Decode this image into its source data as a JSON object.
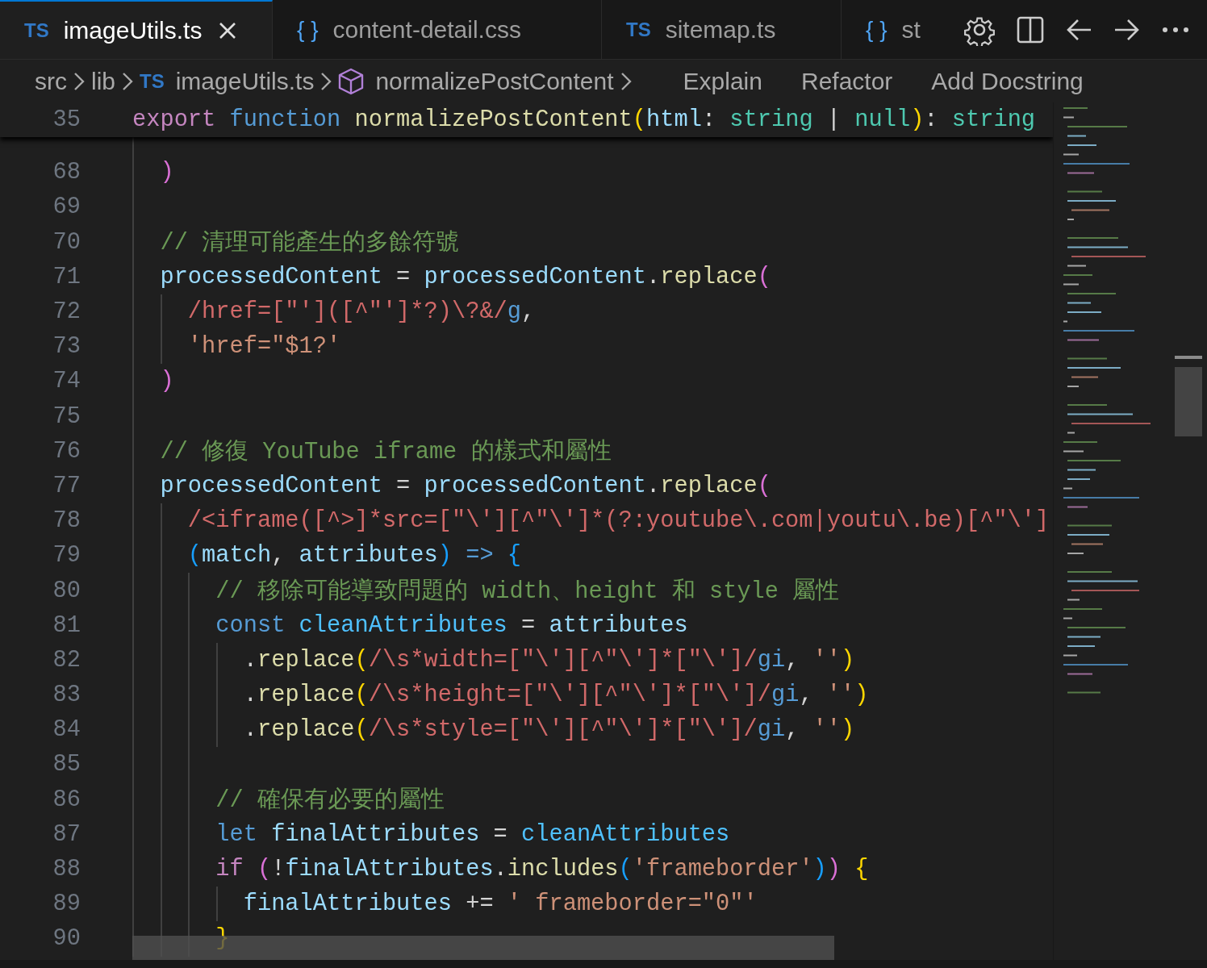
{
  "tabs": [
    {
      "icon": "TS",
      "kind": "ts",
      "label": "imageUtils.ts",
      "selected": true
    },
    {
      "icon": "{ }",
      "kind": "css",
      "label": "content-detail.css",
      "selected": false
    },
    {
      "icon": "TS",
      "kind": "ts",
      "label": "sitemap.ts",
      "selected": false
    },
    {
      "icon": "{ }",
      "kind": "css",
      "label": "st",
      "selected": false
    }
  ],
  "breadcrumb": [
    {
      "label": "src",
      "kind": "folder"
    },
    {
      "label": "lib",
      "kind": "folder"
    },
    {
      "label": "imageUtils.ts",
      "kind": "file",
      "icon": "TS"
    },
    {
      "label": "normalizePostContent",
      "kind": "symbol"
    }
  ],
  "actions": [
    "Explain",
    "Refactor",
    "Add Docstring"
  ],
  "sticky_line": {
    "number": "35",
    "tokens": [
      {
        "text": "export",
        "kind": "kw"
      },
      {
        "text": " function",
        "kind": "st"
      },
      {
        "text": " normalizePostContent",
        "kind": "fn"
      },
      {
        "text": "(",
        "kind": "b1"
      },
      {
        "text": "html",
        "kind": "var"
      },
      {
        "text": ": ",
        "kind": "p"
      },
      {
        "text": "string",
        "kind": "type"
      },
      {
        "text": " | ",
        "kind": "p"
      },
      {
        "text": "null",
        "kind": "type"
      },
      {
        "text": ")",
        "kind": "b1"
      },
      {
        "text": ": ",
        "kind": "p"
      },
      {
        "text": "string",
        "kind": "type"
      }
    ]
  },
  "lines": [
    {
      "number": "68",
      "tokens": [
        {
          "text": "  )",
          "kind": "b2"
        }
      ]
    },
    {
      "number": "69"
    },
    {
      "number": "70",
      "tokens": [
        {
          "text": "  // 清理可能產生的多餘符號",
          "kind": "cm"
        }
      ]
    },
    {
      "number": "71",
      "tokens": [
        {
          "text": "  processedContent",
          "kind": "var"
        },
        {
          "text": " = ",
          "kind": "p"
        },
        {
          "text": "processedContent",
          "kind": "var"
        },
        {
          "text": ".",
          "kind": "p"
        },
        {
          "text": "replace",
          "kind": "fn"
        },
        {
          "text": "(",
          "kind": "b2"
        }
      ]
    },
    {
      "number": "72",
      "tokens": [
        {
          "text": "    /href=[\"']([^\"']*?)\\?&/",
          "kind": "re"
        },
        {
          "text": "g",
          "kind": "flag"
        },
        {
          "text": ",",
          "kind": "p"
        }
      ]
    },
    {
      "number": "73",
      "tokens": [
        {
          "text": "    'href=\"$1?'",
          "kind": "str"
        }
      ]
    },
    {
      "number": "74",
      "tokens": [
        {
          "text": "  )",
          "kind": "b2"
        }
      ]
    },
    {
      "number": "75"
    },
    {
      "number": "76",
      "tokens": [
        {
          "text": "  // 修復 YouTube iframe 的樣式和屬性",
          "kind": "cm"
        }
      ]
    },
    {
      "number": "77",
      "tokens": [
        {
          "text": "  processedContent",
          "kind": "var"
        },
        {
          "text": " = ",
          "kind": "p"
        },
        {
          "text": "processedContent",
          "kind": "var"
        },
        {
          "text": ".",
          "kind": "p"
        },
        {
          "text": "replace",
          "kind": "fn"
        },
        {
          "text": "(",
          "kind": "b2"
        }
      ]
    },
    {
      "number": "78",
      "tokens": [
        {
          "text": "    /<iframe([^>]*src=[\"\\'][^\"\\']*(?:youtube\\.com|youtu\\.be)[^\"\\']",
          "kind": "re"
        }
      ]
    },
    {
      "number": "79",
      "tokens": [
        {
          "text": "    (",
          "kind": "b3"
        },
        {
          "text": "match",
          "kind": "var"
        },
        {
          "text": ", ",
          "kind": "p"
        },
        {
          "text": "attributes",
          "kind": "var"
        },
        {
          "text": ")",
          "kind": "b3"
        },
        {
          "text": " =>",
          "kind": "st"
        },
        {
          "text": " {",
          "kind": "b3"
        }
      ]
    },
    {
      "number": "80",
      "tokens": [
        {
          "text": "      // 移除可能導致問題的 width、height 和 style 屬性",
          "kind": "cm"
        }
      ]
    },
    {
      "number": "81",
      "tokens": [
        {
          "text": "      const",
          "kind": "st"
        },
        {
          "text": " cleanAttributes",
          "kind": "const"
        },
        {
          "text": " = ",
          "kind": "p"
        },
        {
          "text": "attributes",
          "kind": "var"
        }
      ]
    },
    {
      "number": "82",
      "tokens": [
        {
          "text": "        .",
          "kind": "p"
        },
        {
          "text": "replace",
          "kind": "fn"
        },
        {
          "text": "(",
          "kind": "b1"
        },
        {
          "text": "/\\s*width=[\"\\'][^\"\\']*[\"\\']/",
          "kind": "re"
        },
        {
          "text": "gi",
          "kind": "flag"
        },
        {
          "text": ", ",
          "kind": "p"
        },
        {
          "text": "''",
          "kind": "str"
        },
        {
          "text": ")",
          "kind": "b1"
        }
      ]
    },
    {
      "number": "83",
      "tokens": [
        {
          "text": "        .",
          "kind": "p"
        },
        {
          "text": "replace",
          "kind": "fn"
        },
        {
          "text": "(",
          "kind": "b1"
        },
        {
          "text": "/\\s*height=[\"\\'][^\"\\']*[\"\\']/",
          "kind": "re"
        },
        {
          "text": "gi",
          "kind": "flag"
        },
        {
          "text": ", ",
          "kind": "p"
        },
        {
          "text": "''",
          "kind": "str"
        },
        {
          "text": ")",
          "kind": "b1"
        }
      ]
    },
    {
      "number": "84",
      "tokens": [
        {
          "text": "        .",
          "kind": "p"
        },
        {
          "text": "replace",
          "kind": "fn"
        },
        {
          "text": "(",
          "kind": "b1"
        },
        {
          "text": "/\\s*style=[\"\\'][^\"\\']*[\"\\']/",
          "kind": "re"
        },
        {
          "text": "gi",
          "kind": "flag"
        },
        {
          "text": ", ",
          "kind": "p"
        },
        {
          "text": "''",
          "kind": "str"
        },
        {
          "text": ")",
          "kind": "b1"
        }
      ]
    },
    {
      "number": "85"
    },
    {
      "number": "86",
      "tokens": [
        {
          "text": "      // 確保有必要的屬性",
          "kind": "cm"
        }
      ]
    },
    {
      "number": "87",
      "tokens": [
        {
          "text": "      let",
          "kind": "st"
        },
        {
          "text": " finalAttributes",
          "kind": "var"
        },
        {
          "text": " = ",
          "kind": "p"
        },
        {
          "text": "cleanAttributes",
          "kind": "const"
        }
      ]
    },
    {
      "number": "88",
      "tokens": [
        {
          "text": "      if",
          "kind": "kw"
        },
        {
          "text": " (",
          "kind": "b2"
        },
        {
          "text": "!",
          "kind": "p"
        },
        {
          "text": "finalAttributes",
          "kind": "var"
        },
        {
          "text": ".",
          "kind": "p"
        },
        {
          "text": "includes",
          "kind": "fn"
        },
        {
          "text": "(",
          "kind": "b3"
        },
        {
          "text": "'frameborder'",
          "kind": "str"
        },
        {
          "text": ")",
          "kind": "b3"
        },
        {
          "text": ")",
          "kind": "b2"
        },
        {
          "text": " {",
          "kind": "b1"
        }
      ]
    },
    {
      "number": "89",
      "tokens": [
        {
          "text": "        finalAttributes",
          "kind": "var"
        },
        {
          "text": " += ",
          "kind": "p"
        },
        {
          "text": "' frameborder=\"0\"'",
          "kind": "str"
        }
      ]
    },
    {
      "number": "90",
      "tokens": [
        {
          "text": "      }",
          "kind": "b1"
        }
      ]
    }
  ]
}
